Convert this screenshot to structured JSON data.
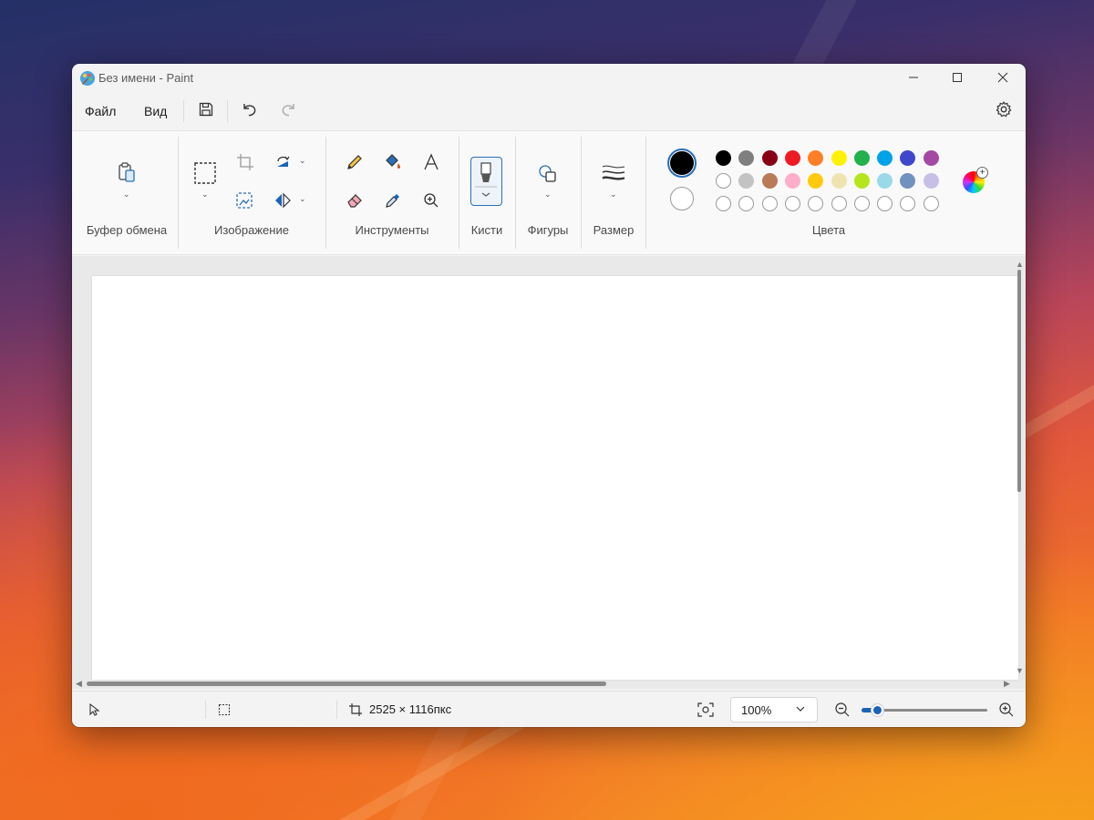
{
  "window": {
    "title": "Без имени - Paint"
  },
  "menu": {
    "file": "Файл",
    "view": "Вид"
  },
  "ribbon": {
    "groups": {
      "clipboard": "Буфер обмена",
      "image": "Изображение",
      "tools": "Инструменты",
      "brushes": "Кисти",
      "shapes": "Фигуры",
      "size": "Размер",
      "colors": "Цвета"
    },
    "colors": {
      "primary": "#000000",
      "secondary": "#ffffff",
      "palette_row1": [
        "#000000",
        "#7f7f7f",
        "#880015",
        "#ed1c24",
        "#ff7f27",
        "#fff200",
        "#22b14c",
        "#00a2e8",
        "#3f48cc",
        "#a349a4"
      ],
      "palette_row2": [
        "#ffffff",
        "#c3c3c3",
        "#b97a57",
        "#ffaec9",
        "#ffc90e",
        "#efe4b0",
        "#b5e61d",
        "#99d9ea",
        "#7092be",
        "#c8bfe7"
      ],
      "custom_slots": 10
    }
  },
  "status": {
    "canvas_size": "2525 × 1116пкс",
    "zoom": "100%",
    "zoom_level": 0.12
  }
}
